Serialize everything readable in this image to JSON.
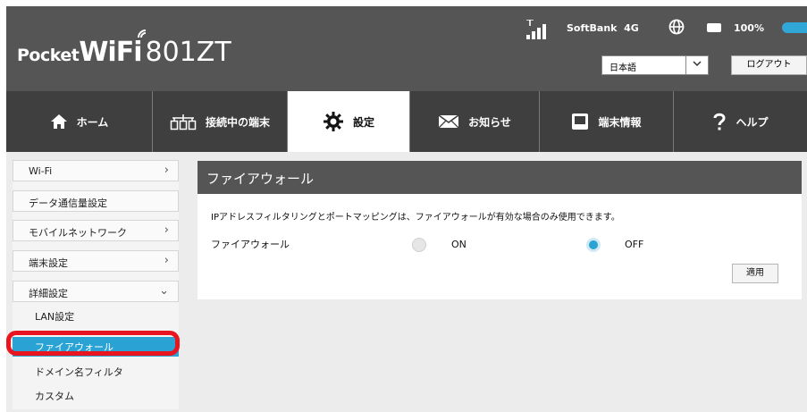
{
  "header": {
    "brand_pocket": "Pocket",
    "brand_wifi": "WiFi",
    "model": "801ZT",
    "carrier": "SoftBank",
    "network_type": "4G",
    "battery": "100%",
    "language": "日本語",
    "logout": "ログアウト"
  },
  "nav": [
    {
      "label": "ホーム",
      "icon": "home-icon"
    },
    {
      "label": "接続中の端末",
      "icon": "devices-icon"
    },
    {
      "label": "設定",
      "icon": "gear-icon",
      "active": true
    },
    {
      "label": "お知らせ",
      "icon": "mail-icon"
    },
    {
      "label": "端末情報",
      "icon": "device-info-icon"
    },
    {
      "label": "ヘルプ",
      "icon": "help-icon"
    }
  ],
  "sidebar": {
    "items": [
      {
        "label": "Wi-Fi",
        "chevron": "›"
      },
      {
        "label": "データ通信量設定",
        "chevron": ""
      },
      {
        "label": "モバイルネットワーク",
        "chevron": "›"
      },
      {
        "label": "端末設定",
        "chevron": "›"
      },
      {
        "label": "詳細設定",
        "chevron": "⌄"
      }
    ],
    "subitems": [
      {
        "label": "LAN設定"
      },
      {
        "label": "ファイアウォール",
        "active": true
      },
      {
        "label": "ドメイン名フィルタ"
      },
      {
        "label": "カスタム"
      }
    ]
  },
  "panel": {
    "title": "ファイアウォール",
    "description": "IPアドレスフィルタリングとポートマッピングは、ファイアウォールが有効な場合のみ使用できます。",
    "row_label": "ファイアウォール",
    "option_on": "ON",
    "option_off": "OFF",
    "selected": "OFF",
    "apply": "適用"
  },
  "colors": {
    "header_bg": "#555555",
    "nav_bg": "#3f3f3f",
    "accent": "#2aa3d4",
    "highlight": "#e8141f"
  }
}
